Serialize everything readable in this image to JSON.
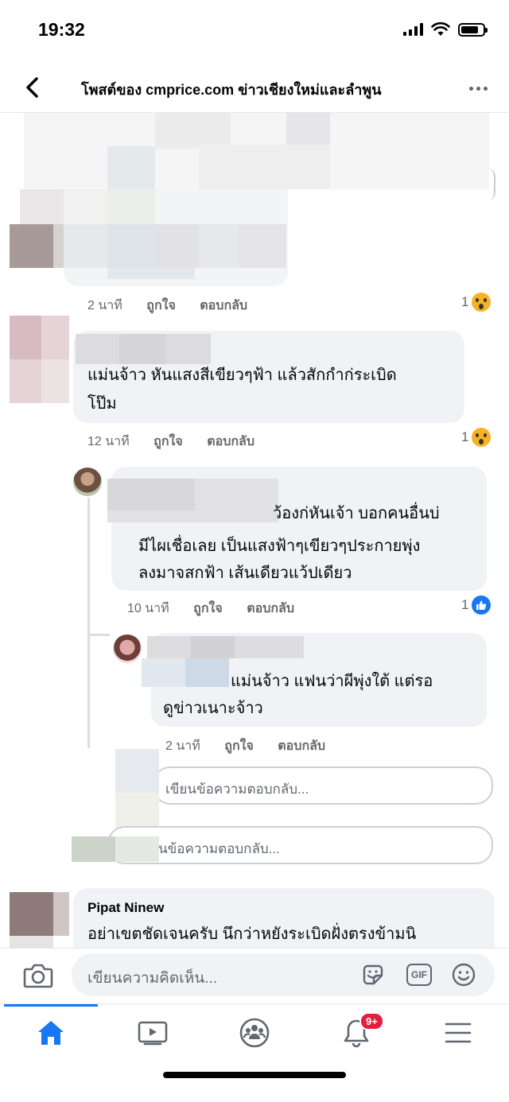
{
  "status_bar": {
    "time": "19:32",
    "battery_level": 0.8
  },
  "header": {
    "title": "โพสต์ของ cmprice.com ข่าวเชียงใหม่และลำพูน"
  },
  "comments": [
    {
      "time": "2 นาที",
      "like": "ถูกใจ",
      "reply": "ตอบกลับ",
      "reaction_count": "1",
      "reaction": "wow"
    },
    {
      "text_line1": "แม่นจ้าว หันแสงสีเขียวๆฟ้า แล้วสักกำก่ระเบิด",
      "text_line2": "โป๊ม",
      "time": "12 นาที",
      "like": "ถูกใจ",
      "reply": "ตอบกลับ",
      "reaction_count": "1",
      "reaction": "wow"
    },
    {
      "text_line1": "ว้องก่หันเจ้า บอกคนอื่นบ่",
      "text_line2": "มีไผเชื่อเลย เป็นแสงฟ้าๆเขียวๆประกายพุ่ง",
      "text_line3": "ลงมาจสกฟ้า เส้นเดียวแว้ปเดียว",
      "time": "10 นาที",
      "like": "ถูกใจ",
      "reply": "ตอบกลับ",
      "reaction_count": "1",
      "reaction": "like"
    },
    {
      "text_line1": "แม่นจ้าว แฟนว่าผีพุ่งใต้ แต่รอ",
      "text_line2": "ดูข่าวเนาะจ้าว",
      "time": "2 นาที",
      "like": "ถูกใจ",
      "reply": "ตอบกลับ"
    },
    {
      "author": "Pipat Ninew",
      "text_line1": "อย่าเขตชัดเจนครับ นึกว่าหยังระเบิดฝั่งตรงข้ามนิ"
    }
  ],
  "reply_inputs": [
    {
      "placeholder": "เขียนข้อความตอบกลับ..."
    },
    {
      "placeholder": "นข้อความตอบกลับ..."
    }
  ],
  "composer": {
    "placeholder": "เขียนความคิดเห็น...",
    "gif_label": "GIF"
  },
  "tabbar": {
    "tabs": [
      {
        "icon": "home-icon",
        "active": true
      },
      {
        "icon": "video-icon"
      },
      {
        "icon": "groups-icon"
      },
      {
        "icon": "bell-icon",
        "badge": "9+"
      },
      {
        "icon": "menu-icon"
      }
    ]
  },
  "colors": {
    "accent": "#1877f2",
    "bubble": "#f0f2f5",
    "badge": "#e41e3f",
    "wow": "#f7b125"
  }
}
